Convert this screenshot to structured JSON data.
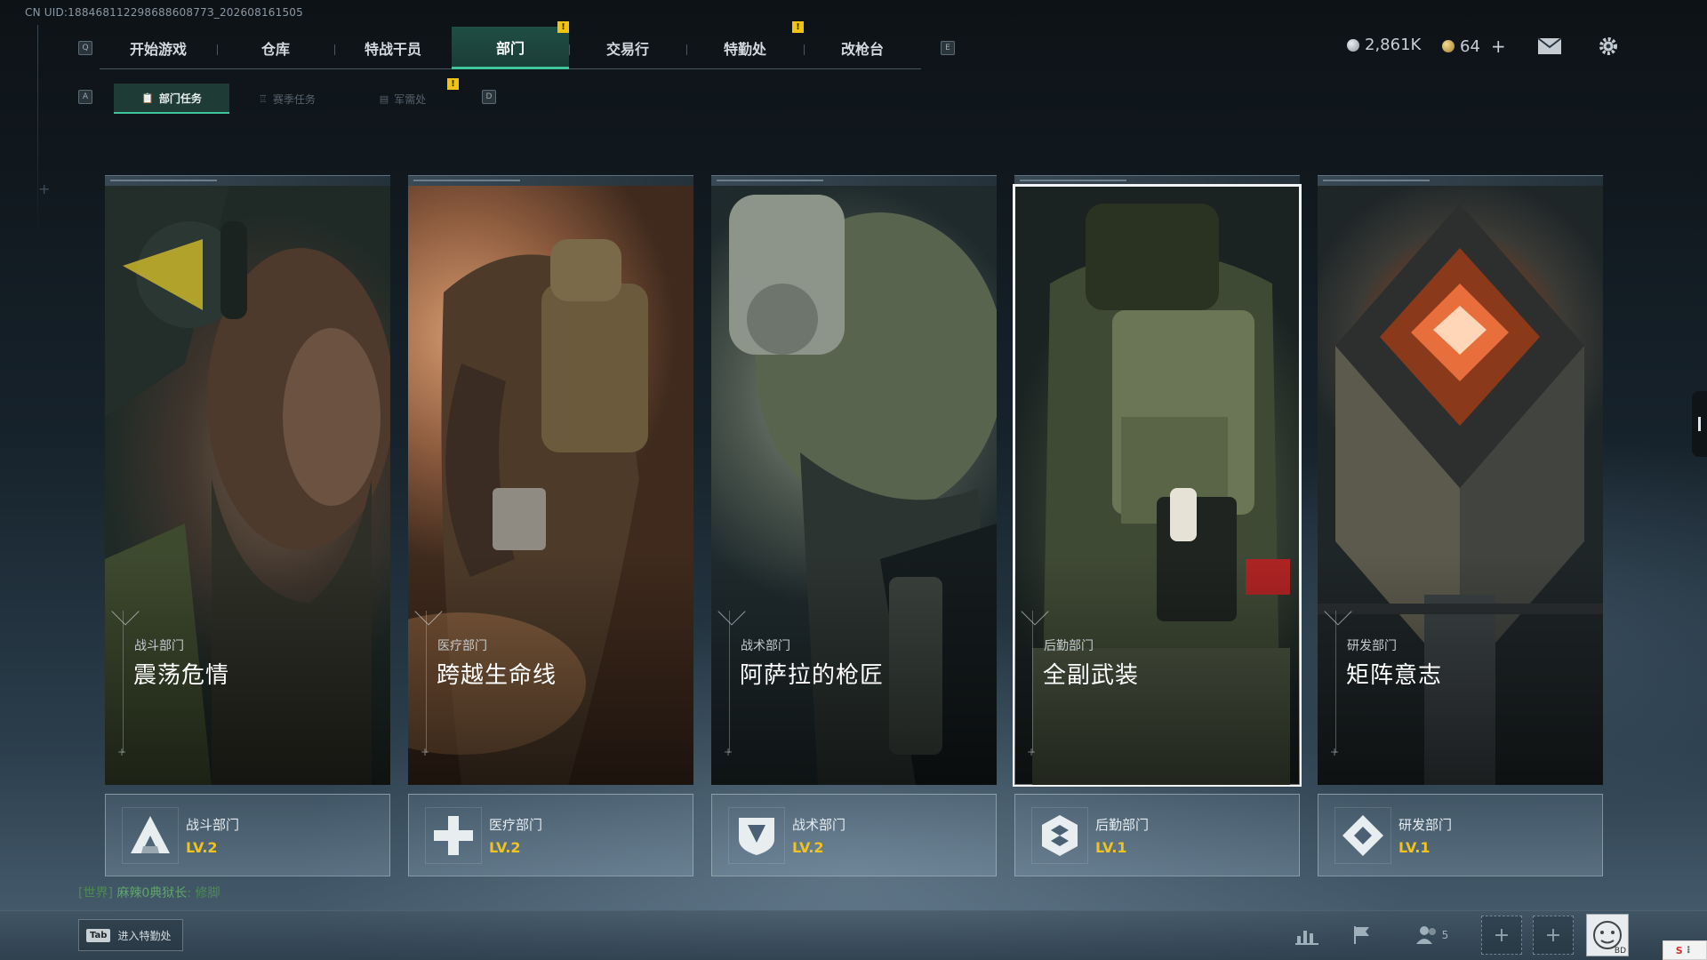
{
  "uid": "CN UID:18846811229868860877З_202608161505",
  "top_nav": {
    "left_key": "Q",
    "right_key": "E",
    "tabs": [
      {
        "label": "开始游戏",
        "active": false,
        "badge": ""
      },
      {
        "label": "仓库",
        "active": false,
        "badge": ""
      },
      {
        "label": "特战干员",
        "active": false,
        "badge": ""
      },
      {
        "label": "部门",
        "active": true,
        "badge": "!"
      },
      {
        "label": "交易行",
        "active": false,
        "badge": ""
      },
      {
        "label": "特勤处",
        "active": false,
        "badge": "!"
      },
      {
        "label": "改枪台",
        "active": false,
        "badge": ""
      }
    ]
  },
  "sub_nav": {
    "left_key": "A",
    "right_key": "D",
    "badge": "!",
    "tabs": [
      {
        "label": "部门任务",
        "icon": "clipboard-icon",
        "active": true
      },
      {
        "label": "赛季任务",
        "icon": "trophy-icon",
        "active": false
      },
      {
        "label": "军需处",
        "icon": "crate-icon",
        "active": false
      }
    ]
  },
  "currency": {
    "silver": {
      "value": "2,861K",
      "icon": "silver-coin-icon"
    },
    "gold": {
      "value": "64",
      "icon": "gold-coin-icon",
      "add": "+"
    }
  },
  "icons": {
    "mail": "mail-icon",
    "settings": "gear-icon"
  },
  "departments": [
    {
      "category": "战斗部门",
      "title": "震荡危情",
      "name": "战斗部门",
      "level": "LV.2",
      "emblem": "combat-emblem-icon",
      "selected": false
    },
    {
      "category": "医疗部门",
      "title": "跨越生命线",
      "name": "医疗部门",
      "level": "LV.2",
      "emblem": "medical-cross-icon",
      "selected": false
    },
    {
      "category": "战术部门",
      "title": "阿萨拉的枪匠",
      "name": "战术部门",
      "level": "LV.2",
      "emblem": "tactical-shield-icon",
      "selected": false
    },
    {
      "category": "后勤部门",
      "title": "全副武装",
      "name": "后勤部门",
      "level": "LV.1",
      "emblem": "logistics-hex-icon",
      "selected": true
    },
    {
      "category": "研发部门",
      "title": "矩阵意志",
      "name": "研发部门",
      "level": "LV.1",
      "emblem": "research-diamond-icon",
      "selected": false
    }
  ],
  "chat": {
    "channel": "[世界]",
    "sender": "麻辣0典狱长",
    "message": ": 修脚"
  },
  "bottom": {
    "tab_key": "Tab",
    "tab_label": "进入特勤处",
    "friends_count": "5",
    "slot_plus": "+",
    "avatar_label": "BD"
  },
  "ime": {
    "label": "S"
  }
}
